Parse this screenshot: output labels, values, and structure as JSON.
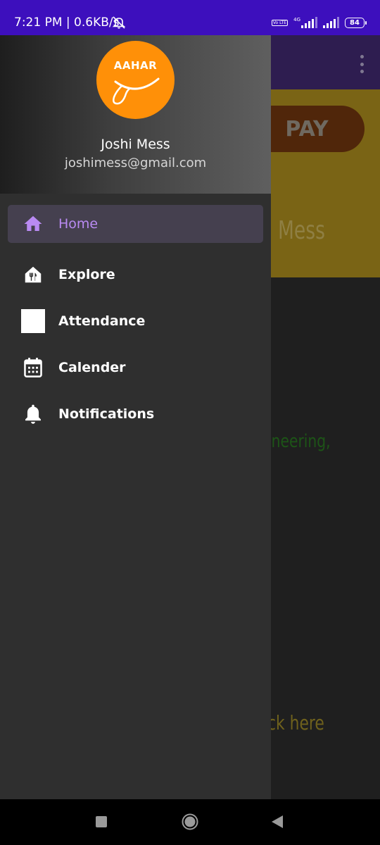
{
  "status_bar": {
    "time": "7:21 PM | 0.6KB/s",
    "volte_label": "Vo LTE",
    "network_label": "4G",
    "battery": "84"
  },
  "background_app": {
    "pay_label": "PAY",
    "mess_text": "Mess",
    "engineering_text": "ineering,",
    "click_text": "ck here"
  },
  "drawer": {
    "logo_text": "AAHAR",
    "user_name": "Joshi Mess",
    "user_email": "joshimess@gmail.com",
    "items": [
      {
        "label": "Home",
        "icon": "home-icon",
        "selected": true
      },
      {
        "label": "Explore",
        "icon": "restaurant-icon"
      },
      {
        "label": "Attendance",
        "icon": "attendance-icon"
      },
      {
        "label": "Calender",
        "icon": "calendar-icon"
      },
      {
        "label": "Notifications",
        "icon": "bell-icon"
      }
    ],
    "accent_color": "#b98af2"
  },
  "colors": {
    "status_bar": "#3d0fbd",
    "logo_bg": "#ff9008",
    "drawer_bg": "#2f2f2f"
  }
}
